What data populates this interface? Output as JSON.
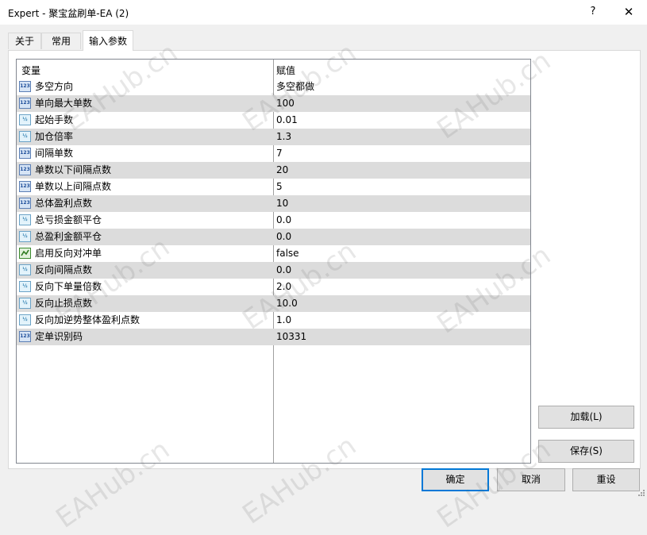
{
  "window": {
    "title": "Expert - 聚宝盆刷单-EA (2)",
    "help": "?",
    "close": "✕"
  },
  "tabs": [
    {
      "label": "关于",
      "active": false
    },
    {
      "label": "常用",
      "active": false
    },
    {
      "label": "输入参数",
      "active": true
    }
  ],
  "grid": {
    "col_variable": "变量",
    "col_value": "赋值",
    "rows": [
      {
        "icon": "int",
        "icon_text": "123",
        "name": "多空方向",
        "value": "多空都做"
      },
      {
        "icon": "int",
        "icon_text": "123",
        "name": "单向最大单数",
        "value": "100"
      },
      {
        "icon": "double",
        "icon_text": "½",
        "name": "起始手数",
        "value": "0.01"
      },
      {
        "icon": "double",
        "icon_text": "½",
        "name": "加仓倍率",
        "value": "1.3"
      },
      {
        "icon": "int",
        "icon_text": "123",
        "name": "间隔单数",
        "value": "7"
      },
      {
        "icon": "int",
        "icon_text": "123",
        "name": "单数以下间隔点数",
        "value": "20"
      },
      {
        "icon": "int",
        "icon_text": "123",
        "name": "单数以上间隔点数",
        "value": "5"
      },
      {
        "icon": "int",
        "icon_text": "123",
        "name": "总体盈利点数",
        "value": "10"
      },
      {
        "icon": "double",
        "icon_text": "½",
        "name": "总亏损金额平仓",
        "value": "0.0"
      },
      {
        "icon": "double",
        "icon_text": "½",
        "name": "总盈利金额平仓",
        "value": "0.0"
      },
      {
        "icon": "bool",
        "icon_text": "",
        "name": "启用反向对冲单",
        "value": "false"
      },
      {
        "icon": "double",
        "icon_text": "½",
        "name": "反向间隔点数",
        "value": "0.0"
      },
      {
        "icon": "double",
        "icon_text": "½",
        "name": "反向下单量倍数",
        "value": "2.0"
      },
      {
        "icon": "double",
        "icon_text": "½",
        "name": "反向止损点数",
        "value": "10.0"
      },
      {
        "icon": "double",
        "icon_text": "½",
        "name": "反向加逆势整体盈利点数",
        "value": "1.0"
      },
      {
        "icon": "int",
        "icon_text": "123",
        "name": "定单识别码",
        "value": "10331"
      }
    ]
  },
  "buttons": {
    "load": "加载(L)",
    "save": "保存(S)",
    "ok": "确定",
    "cancel": "取消",
    "reset": "重设"
  },
  "watermark": "EAHub.cn"
}
